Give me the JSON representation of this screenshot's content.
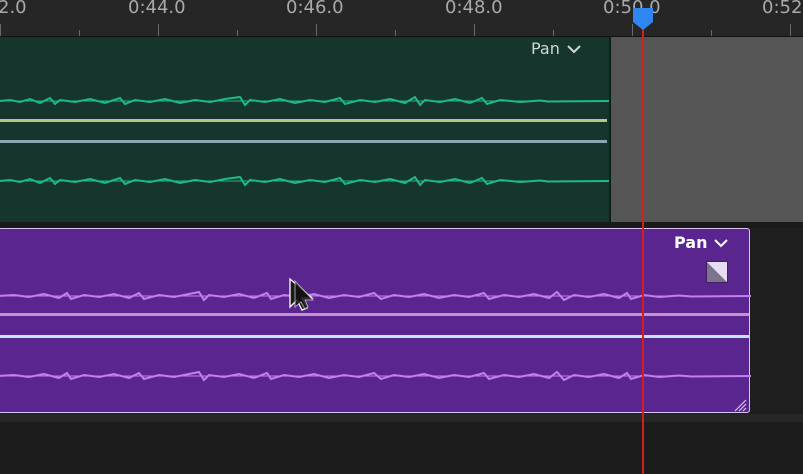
{
  "ruler": {
    "labels": [
      "2.0",
      "0:44.0",
      "0:46.0",
      "0:48.0",
      "0:50.0",
      "0:52"
    ]
  },
  "tracks": {
    "top_clip": {
      "pan_label": "Pan",
      "color": "#16352d",
      "waveform_color": "#1fb88c"
    },
    "bottom_clip": {
      "pan_label": "Pan",
      "color": "#5b2590",
      "waveform_color": "#c47ef0"
    }
  },
  "colors": {
    "playhead": "#d41f1f",
    "playhead_marker": "#2f86f0",
    "ruler_text": "#a9a9a9",
    "empty_region": "#555555"
  },
  "icons": [
    "chevron-down-icon",
    "fade-handle-icon",
    "resize-grip-icon",
    "playhead-marker-icon",
    "mouse-cursor-icon"
  ]
}
